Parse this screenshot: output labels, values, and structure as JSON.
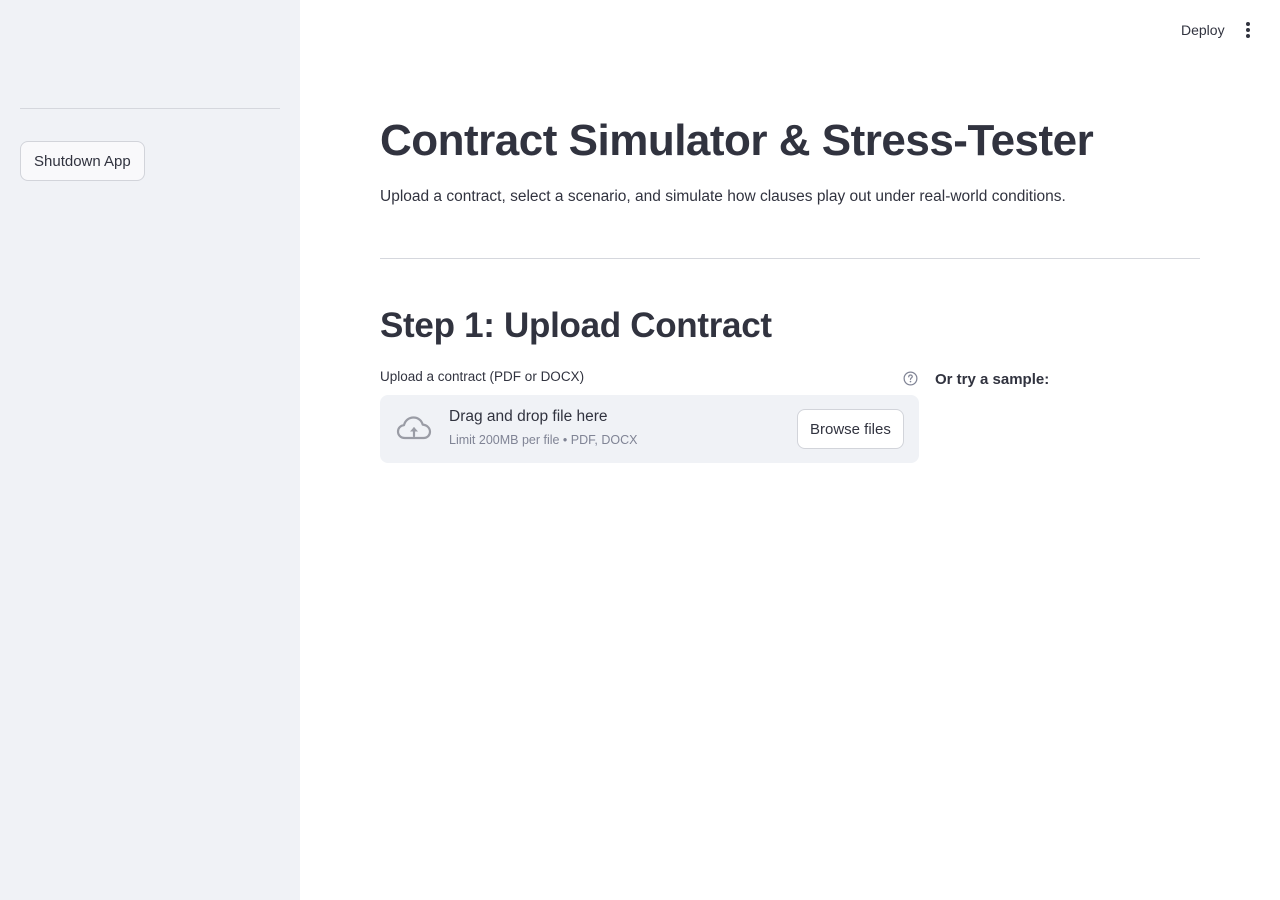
{
  "header": {
    "deploy_label": "Deploy",
    "menu_icon": "vertical-ellipsis-icon"
  },
  "sidebar": {
    "shutdown_label": "Shutdown App"
  },
  "main": {
    "title": "Contract Simulator & Stress-Tester",
    "subtitle": "Upload a contract, select a scenario, and simulate how clauses play out under real-world conditions.",
    "step1_heading": "Step 1: Upload Contract",
    "uploader": {
      "label": "Upload a contract (PDF or DOCX)",
      "help_icon": "question-circle-icon",
      "upload_icon": "cloud-upload-icon",
      "drop_text": "Drag and drop file here",
      "limit_text": "Limit 200MB per file • PDF, DOCX",
      "browse_label": "Browse files"
    },
    "sample_label": "Or try a sample:"
  },
  "colors": {
    "sidebar_bg": "#f0f2f6",
    "text": "#31333f",
    "muted_text": "#808495",
    "border": "#d2d4da"
  }
}
